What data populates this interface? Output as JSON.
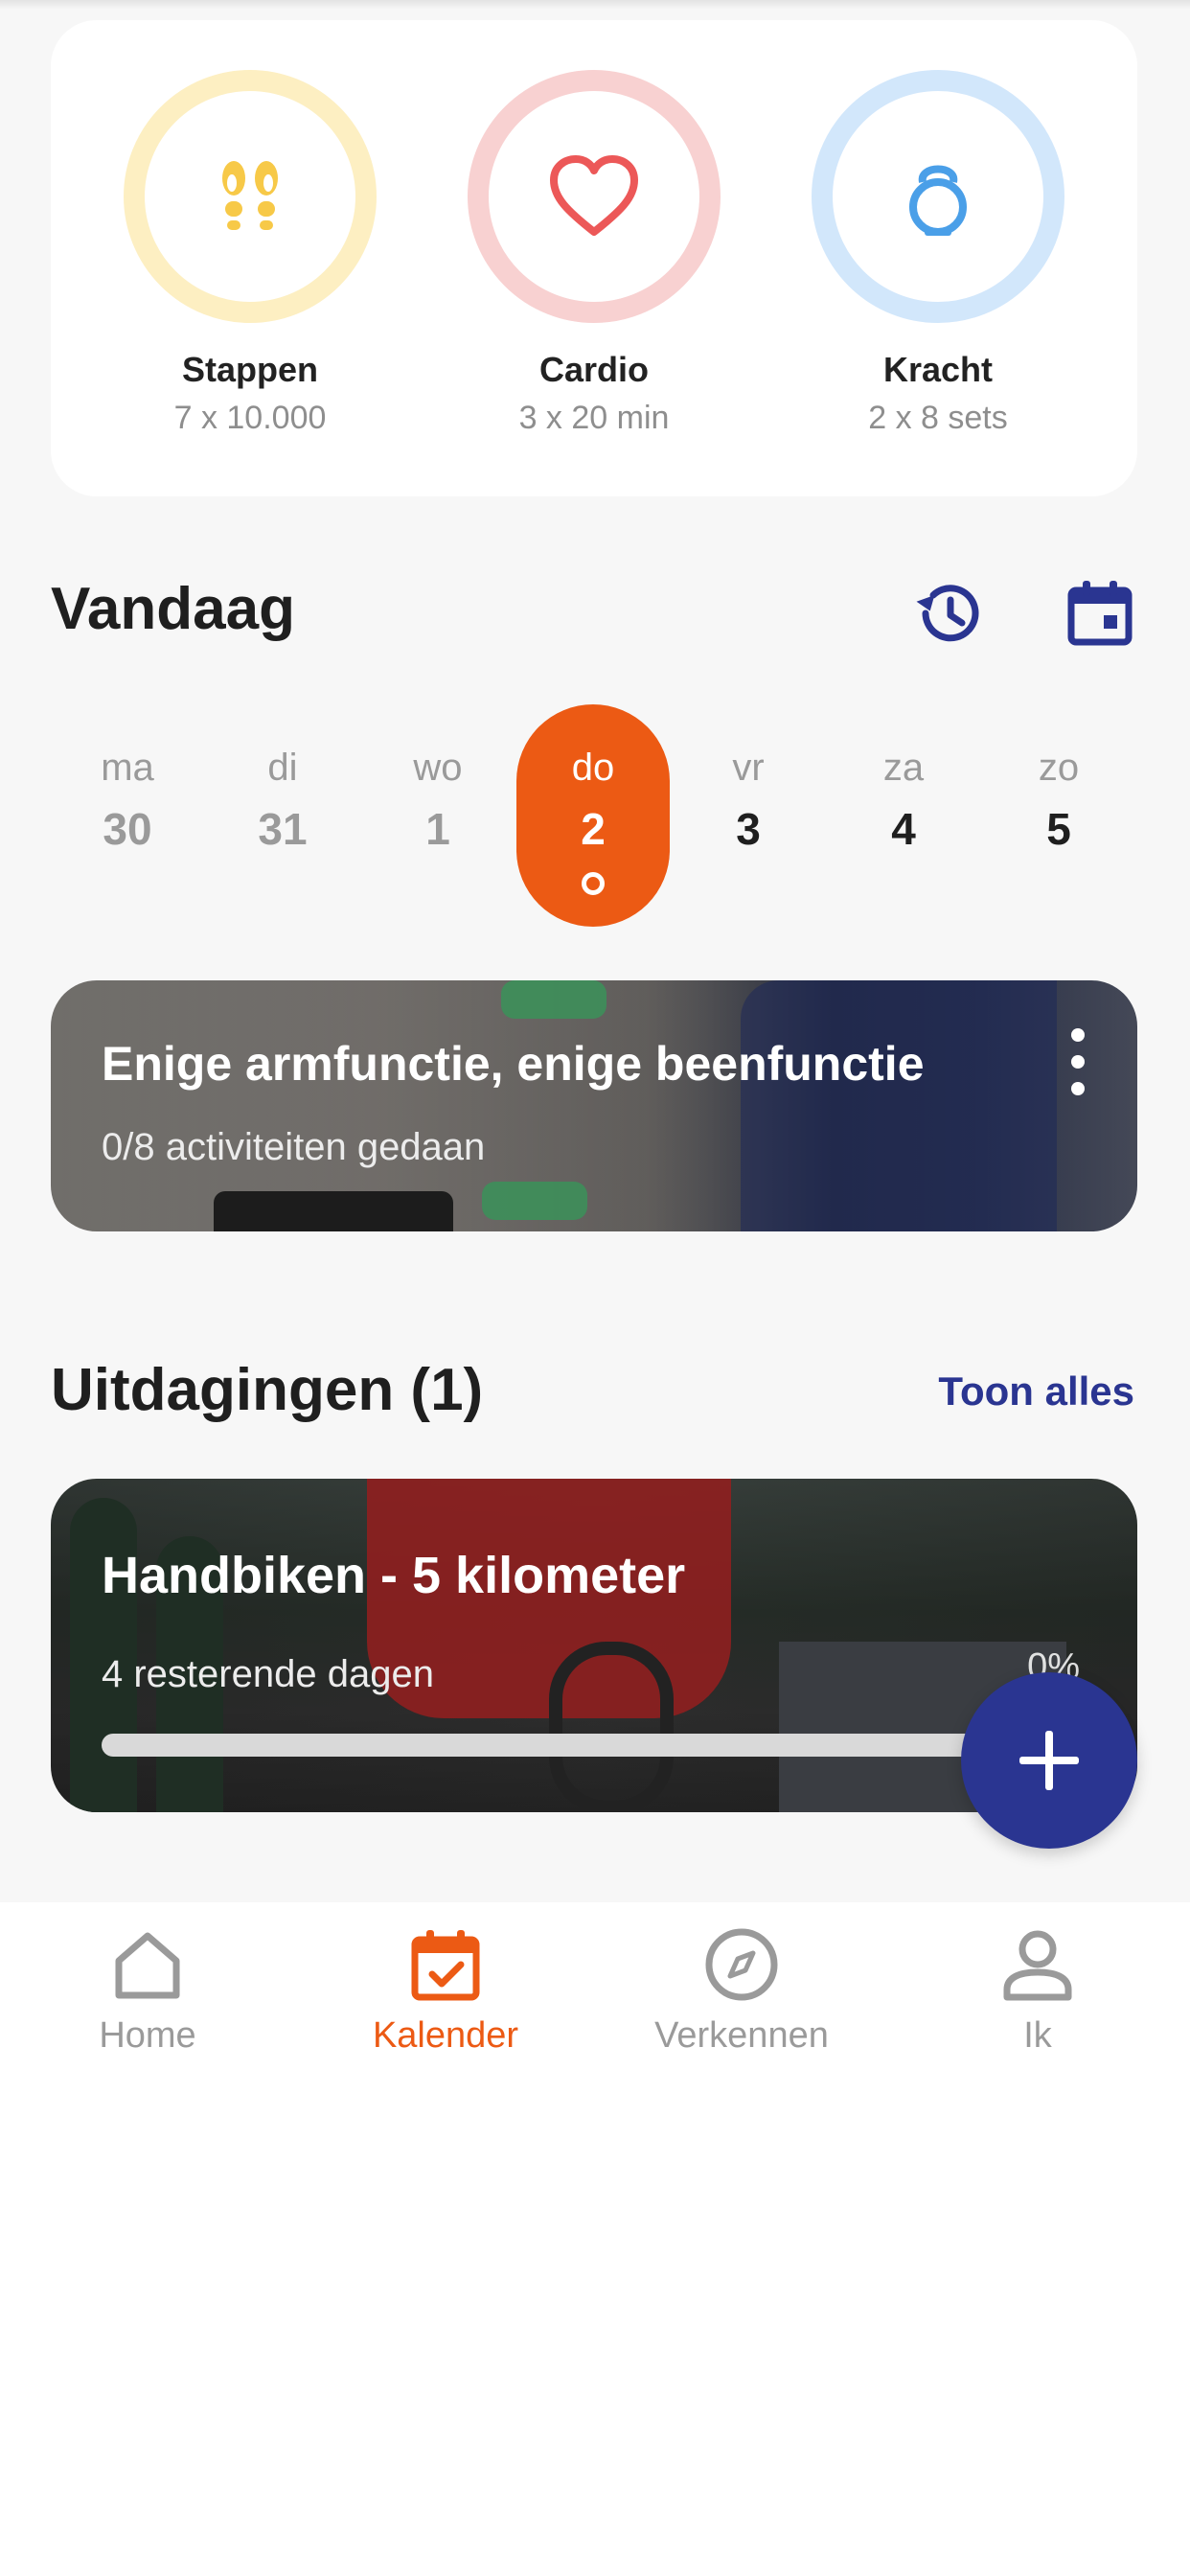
{
  "goals": [
    {
      "title": "Stappen",
      "subtitle": "7 x 10.000",
      "icon": "footsteps-icon",
      "ring_color": "#fdefc2",
      "icon_color": "#f7c948"
    },
    {
      "title": "Cardio",
      "subtitle": "3 x 20 min",
      "icon": "heart-icon",
      "ring_color": "#f8d1d1",
      "icon_color": "#ec5858"
    },
    {
      "title": "Kracht",
      "subtitle": "2 x 8 sets",
      "icon": "kettlebell-icon",
      "ring_color": "#d2e7fb",
      "icon_color": "#4a9fe8"
    }
  ],
  "today": {
    "title": "Vandaag",
    "history_icon": "history-icon",
    "calendar_icon": "calendar-icon"
  },
  "week": [
    {
      "name": "ma",
      "num": "30",
      "state": "past"
    },
    {
      "name": "di",
      "num": "31",
      "state": "past"
    },
    {
      "name": "wo",
      "num": "1",
      "state": "past"
    },
    {
      "name": "do",
      "num": "2",
      "state": "active"
    },
    {
      "name": "vr",
      "num": "3",
      "state": "future"
    },
    {
      "name": "za",
      "num": "4",
      "state": "future"
    },
    {
      "name": "zo",
      "num": "5",
      "state": "future"
    }
  ],
  "activity": {
    "title": "Enige armfunctie, enige beenfunctie",
    "subtitle": "0/8 activiteiten gedaan"
  },
  "challenges": {
    "title": "Uitdagingen (1)",
    "show_all": "Toon alles",
    "card": {
      "title": "Handbiken - 5 kilometer",
      "subtitle": "4 resterende dagen",
      "percent": "0%",
      "progress": 0
    }
  },
  "nav": [
    {
      "label": "Home",
      "icon": "home-icon",
      "active": false
    },
    {
      "label": "Kalender",
      "icon": "calendar-check-icon",
      "active": true
    },
    {
      "label": "Verkennen",
      "icon": "compass-icon",
      "active": false
    },
    {
      "label": "Ik",
      "icon": "user-icon",
      "active": false
    }
  ],
  "colors": {
    "accent": "#ec5a14",
    "primary": "#2a3591",
    "muted": "#9a9a9a"
  }
}
